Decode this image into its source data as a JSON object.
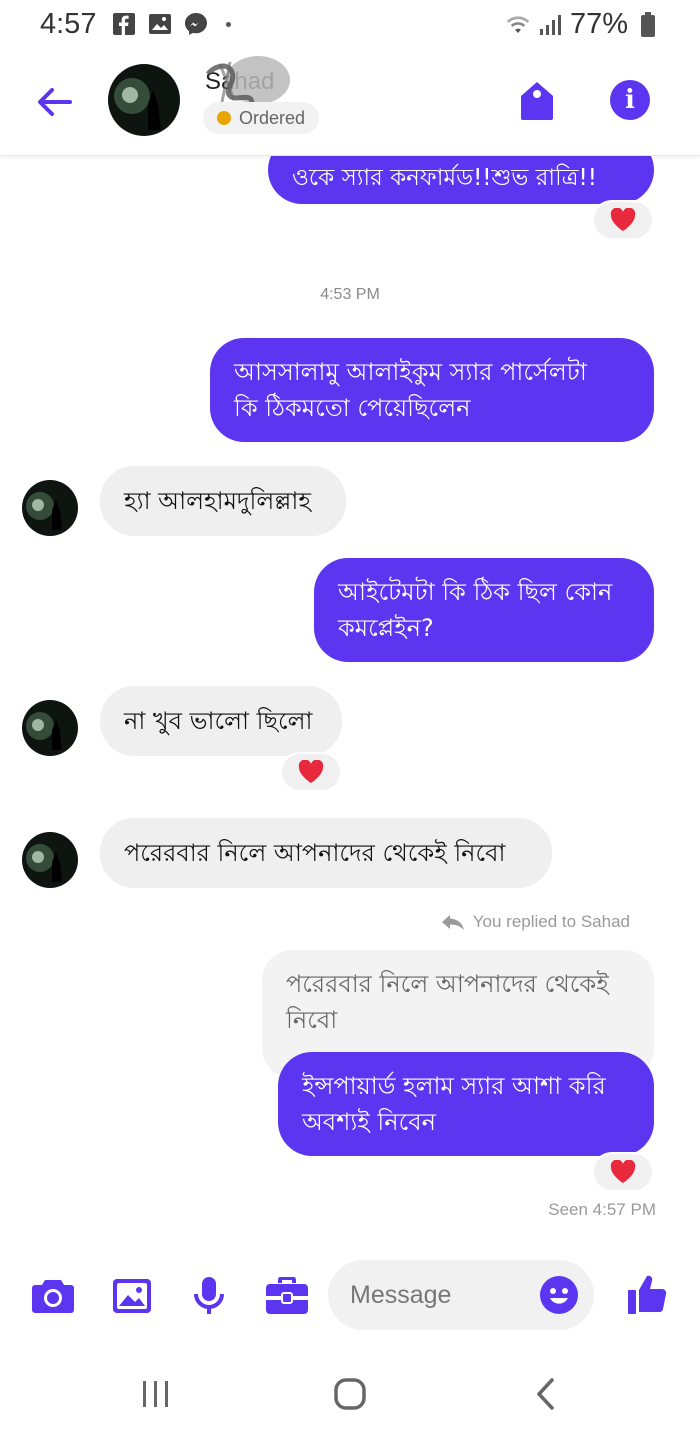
{
  "status_bar": {
    "time": "4:57",
    "battery": "77%"
  },
  "header": {
    "contact_name": "Sahad",
    "badge": "Ordered"
  },
  "messages": [
    {
      "id": "m1",
      "direction": "outgoing",
      "text": "ওকে স্যার কনফার্মড!!শুভ রাত্রি!!",
      "reaction": "heart"
    },
    {
      "id": "ts1",
      "type": "timestamp",
      "text": "4:53 PM"
    },
    {
      "id": "m2",
      "direction": "outgoing",
      "lines": [
        "আসসালামু আলাইকুম স্যার পার্সেলটা",
        "কি ঠিকমতো পেয়েছিলেন"
      ]
    },
    {
      "id": "m3",
      "direction": "incoming",
      "text": "হ্যা আলহামদুলিল্লাহ"
    },
    {
      "id": "m4",
      "direction": "outgoing",
      "lines": [
        "আইটেমটা কি ঠিক ছিল কোন",
        "কমপ্লেইন?"
      ]
    },
    {
      "id": "m5",
      "direction": "incoming",
      "text": "না খুব ভালো ছিলো",
      "reaction": "heart"
    },
    {
      "id": "m6",
      "direction": "incoming",
      "text": "পরেরবার নিলে আপনাদের থেকেই নিবো"
    },
    {
      "id": "m7",
      "direction": "outgoing",
      "reply_label": "You replied to Sahad",
      "quoted_lines": [
        "পরেরবার নিলে আপনাদের থেকেই",
        "নিবো"
      ],
      "lines": [
        "ইন্সপায়ার্ড হলাম স্যার আশা করি",
        "অবশ্যই নিবেন"
      ],
      "reaction": "heart"
    }
  ],
  "seen_text": "Seen 4:57 PM",
  "composer": {
    "placeholder": "Message"
  },
  "colors": {
    "accent": "#5b35f0",
    "incoming_bubble": "#efefef",
    "heart": "#e8283c"
  }
}
